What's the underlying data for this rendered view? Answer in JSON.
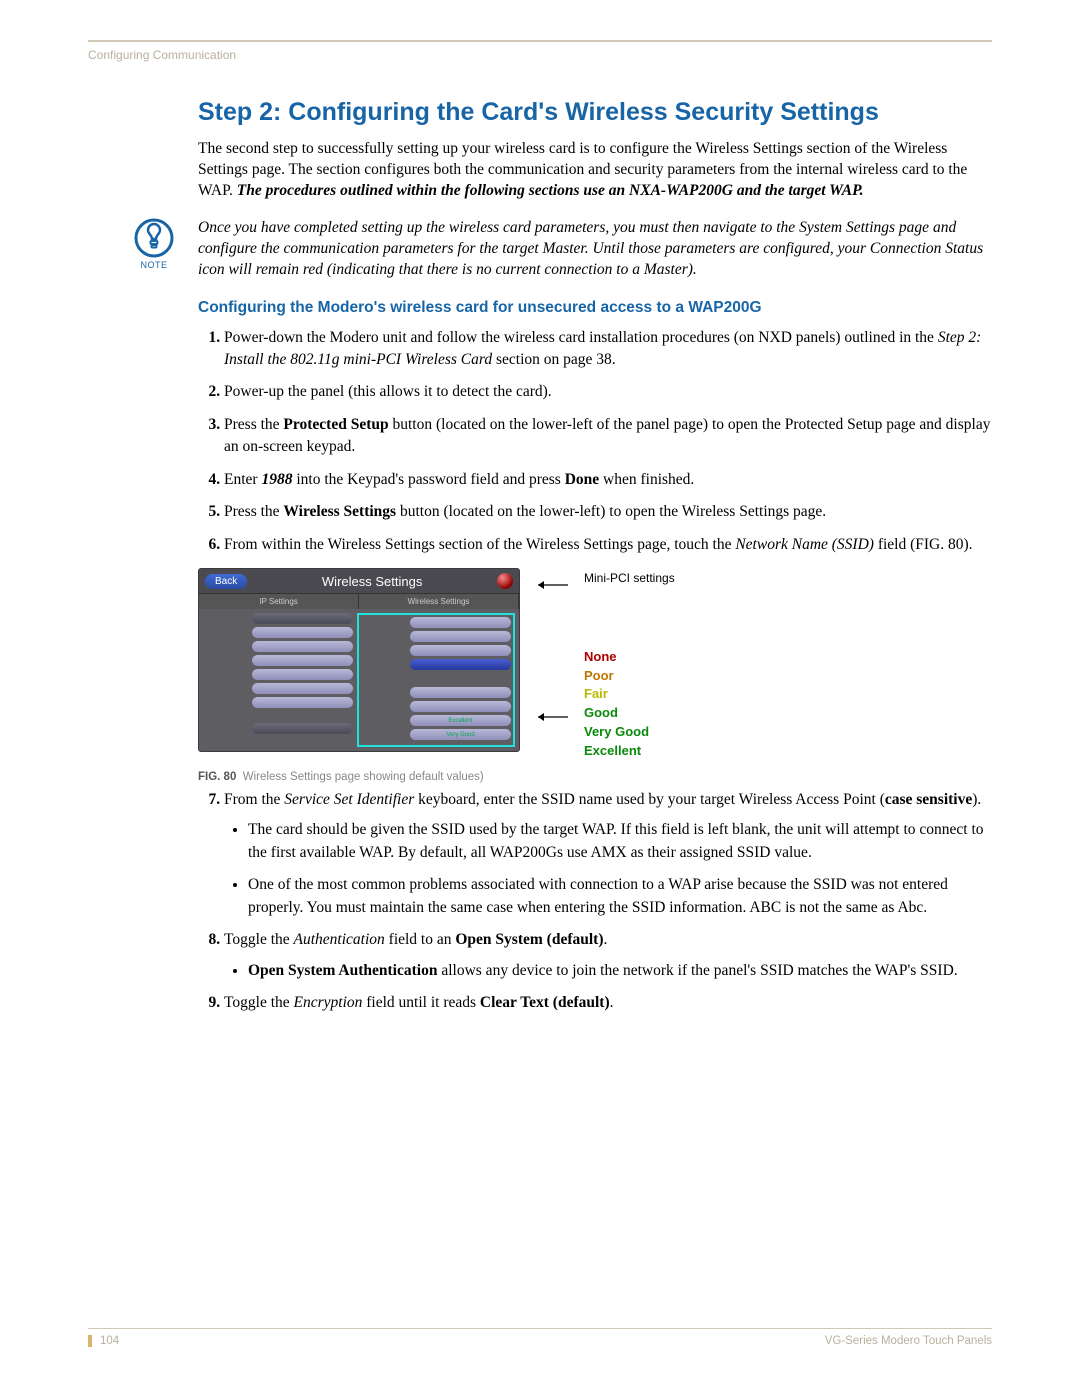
{
  "running_head": "Configuring Communication",
  "title": "Step 2: Configuring the Card's Wireless Security Settings",
  "intro_html": "The second step to successfully setting up your wireless card is to configure the Wireless Settings section of the Wireless Settings page. The section configures both the communication and security parameters from the internal wireless card to the WAP. <b><i>The procedures outlined within the following sections use an NXA-WAP200G and the target WAP.</i></b>",
  "note_label": "NOTE",
  "note_text": "Once you have completed setting up the wireless card parameters, you must then navigate to the System Settings page and configure the communication parameters for the target Master. Until those parameters are configured, your Connection Status icon will remain red (indicating that there is no current connection to a Master).",
  "subheading": "Configuring the Modero's wireless card for unsecured access to a WAP200G",
  "steps": {
    "s1": "Power-down the Modero unit and follow the wireless card installation procedures (on NXD panels) outlined in the <i>Step 2: Install the 802.11g mini-PCI Wireless Card</i> section on page 38.",
    "s2": "Power-up the panel (this allows it to detect the card).",
    "s3": "Press the <b>Protected Setup</b> button (located on the lower-left of the panel page) to open the Protected Setup page and display an on-screen keypad.",
    "s4": "Enter <b><i>1988</i></b> into the Keypad's password field and press <b>Done</b> when finished.",
    "s5": "Press the <b>Wireless Settings</b> button (located on the lower-left) to open the Wireless Settings page.",
    "s6": "From within the Wireless Settings section of the Wireless Settings page, touch the <i>Network Name (SSID)</i> field (FIG. 80).",
    "s7": "From the <i>Service Set Identifier</i> keyboard, enter the SSID name used by your target Wireless Access Point (<b>case sensitive</b>).",
    "s7b1": "The card should be given the SSID used by the target WAP. If this field is left blank, the unit will attempt to connect to the first available WAP. By default, all WAP200Gs use AMX as their assigned SSID value.",
    "s7b2": "One of the most common problems associated with connection to a WAP arise because the SSID was not entered properly. You must maintain the same case when entering the SSID information. ABC is not the same as Abc.",
    "s8": "Toggle the <i>Authentication</i> field to an <b>Open System (default)</b>.",
    "s8b1": "<b>Open System Authentication</b> allows any device to join the network if the panel's SSID matches the WAP's SSID.",
    "s9": "Toggle the <i>Encryption</i> field until it reads <b>Clear Text (default)</b>."
  },
  "figure": {
    "screenshot": {
      "back": "Back",
      "title": "Wireless Settings",
      "tab_left": "IP Settings",
      "tab_right": "Wireless Settings",
      "excellent": "Excellent",
      "very_good": "Very Good"
    },
    "callout_mini": "Mini-PCI settings",
    "quality": {
      "none": "None",
      "poor": "Poor",
      "fair": "Fair",
      "good": "Good",
      "vg": "Very Good",
      "ex": "Excellent"
    },
    "caption_prefix": "FIG. 80",
    "caption_text": "Wireless Settings page showing default values)"
  },
  "footer": {
    "page": "104",
    "doc": "VG-Series Modero Touch Panels"
  }
}
